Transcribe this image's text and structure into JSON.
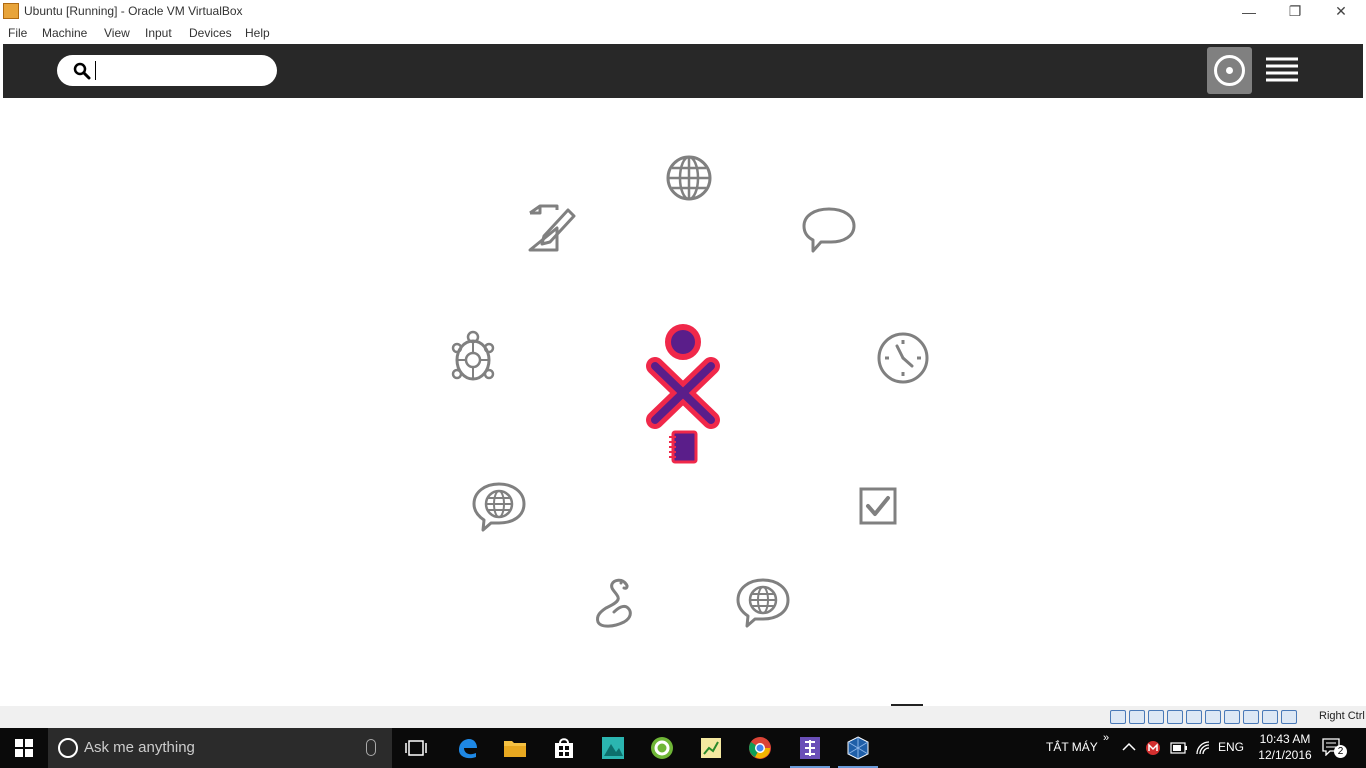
{
  "window": {
    "title": "Ubuntu [Running] - Oracle VM VirtualBox",
    "minimize": "—",
    "restore": "❐",
    "close": "✕"
  },
  "menubar": {
    "items": [
      {
        "label": "File"
      },
      {
        "label": "Machine"
      },
      {
        "label": "View"
      },
      {
        "label": "Input"
      },
      {
        "label": "Devices"
      },
      {
        "label": "Help"
      }
    ]
  },
  "sugar": {
    "search": {
      "value": "",
      "placeholder": ""
    },
    "activities": [
      {
        "name": "browse-activity-icon"
      },
      {
        "name": "write-activity-icon"
      },
      {
        "name": "chat-activity-icon"
      },
      {
        "name": "turtleart-activity-icon"
      },
      {
        "name": "clock-activity-icon"
      },
      {
        "name": "web-chat-activity-icon"
      },
      {
        "name": "checkbox-activity-icon"
      },
      {
        "name": "pippy-python-activity-icon"
      },
      {
        "name": "web-chat-2-activity-icon"
      }
    ],
    "xo_colors": {
      "stroke": "#f0284a",
      "fill": "#5a1e8a"
    }
  },
  "vbox_status": {
    "host_key": "Right Ctrl"
  },
  "taskbar": {
    "search_placeholder": "Ask me anything",
    "shutdown_label": "TẮT MÁY",
    "chevron": "»",
    "language": "ENG",
    "time": "10:43 AM",
    "date": "12/1/2016",
    "notifications": "2"
  }
}
